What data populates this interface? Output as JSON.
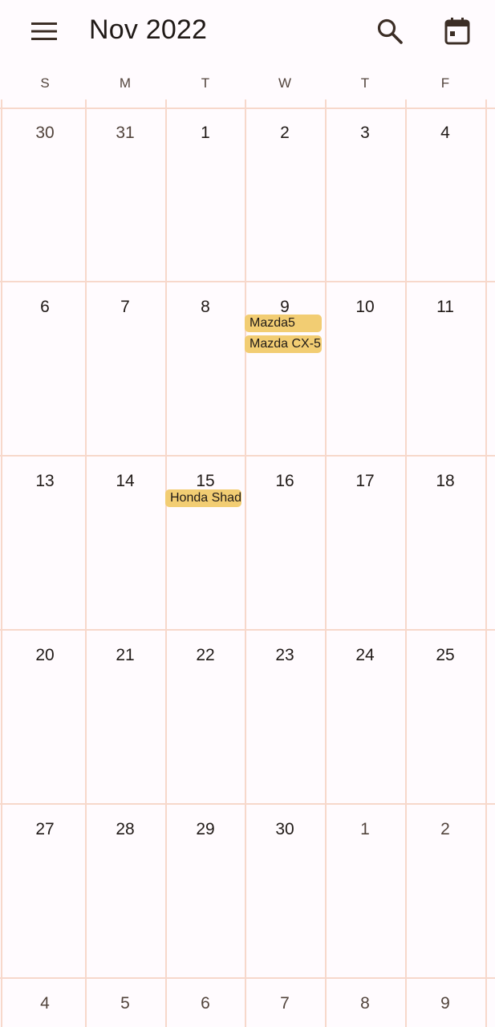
{
  "header": {
    "title": "Nov 2022",
    "icons": {
      "menu": "menu-icon",
      "search": "search-icon",
      "today": "calendar-today-icon"
    }
  },
  "weekdays": [
    "S",
    "M",
    "T",
    "W",
    "T",
    "F"
  ],
  "weeks": [
    {
      "days": [
        "30",
        "31",
        "1",
        "2",
        "3",
        "4"
      ]
    },
    {
      "days": [
        "6",
        "7",
        "8",
        "9",
        "10",
        "11"
      ]
    },
    {
      "days": [
        "13",
        "14",
        "15",
        "16",
        "17",
        "18"
      ]
    },
    {
      "days": [
        "20",
        "21",
        "22",
        "23",
        "24",
        "25"
      ]
    },
    {
      "days": [
        "27",
        "28",
        "29",
        "30",
        "1",
        "2"
      ]
    },
    {
      "days": [
        "4",
        "5",
        "6",
        "7",
        "8",
        "9"
      ]
    }
  ],
  "events": [
    {
      "title": "Mazda5"
    },
    {
      "title": "Mazda CX-5"
    },
    {
      "title": "Honda Shadow"
    }
  ],
  "colors": {
    "background": "#fffbfe",
    "grid_line": "#f7d8cb",
    "event_chip": "#f2cd73",
    "text_primary": "#201a17",
    "text_muted": "#52443c"
  }
}
